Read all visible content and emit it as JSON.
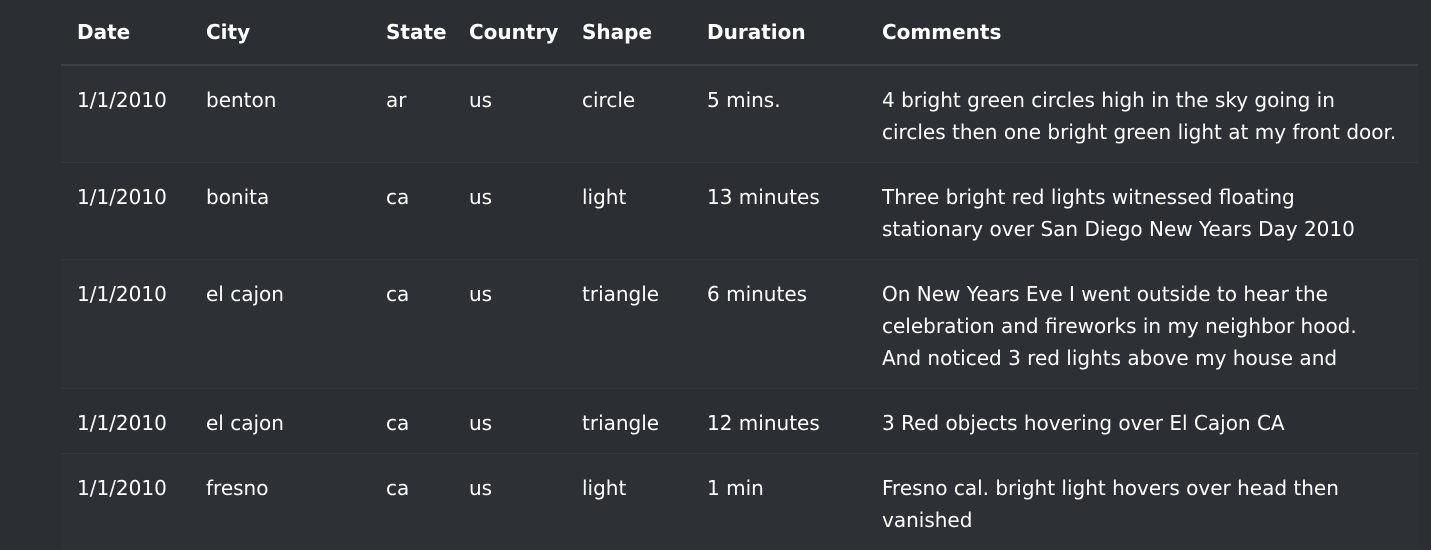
{
  "table": {
    "headers": [
      "Date",
      "City",
      "State",
      "Country",
      "Shape",
      "Duration",
      "Comments"
    ],
    "rows": [
      [
        "1/1/2010",
        "benton",
        "ar",
        "us",
        "circle",
        "5 mins.",
        "4 bright green circles high in the sky going in circles then one bright green light at my front door."
      ],
      [
        "1/1/2010",
        "bonita",
        "ca",
        "us",
        "light",
        "13 minutes",
        "Three bright red lights witnessed floating stationary over San Diego New Years Day 2010"
      ],
      [
        "1/1/2010",
        "el cajon",
        "ca",
        "us",
        "triangle",
        "6 minutes",
        "On New Years Eve I went outside to hear the celebration and fireworks in my neighbor hood. And noticed 3 red lights above my house and"
      ],
      [
        "1/1/2010",
        "el cajon",
        "ca",
        "us",
        "triangle",
        "12 minutes",
        "3 Red objects hovering over El Cajon CA"
      ],
      [
        "1/1/2010",
        "fresno",
        "ca",
        "us",
        "light",
        "1 min",
        "Fresno cal. bright light hovers over head then vanished"
      ]
    ]
  }
}
